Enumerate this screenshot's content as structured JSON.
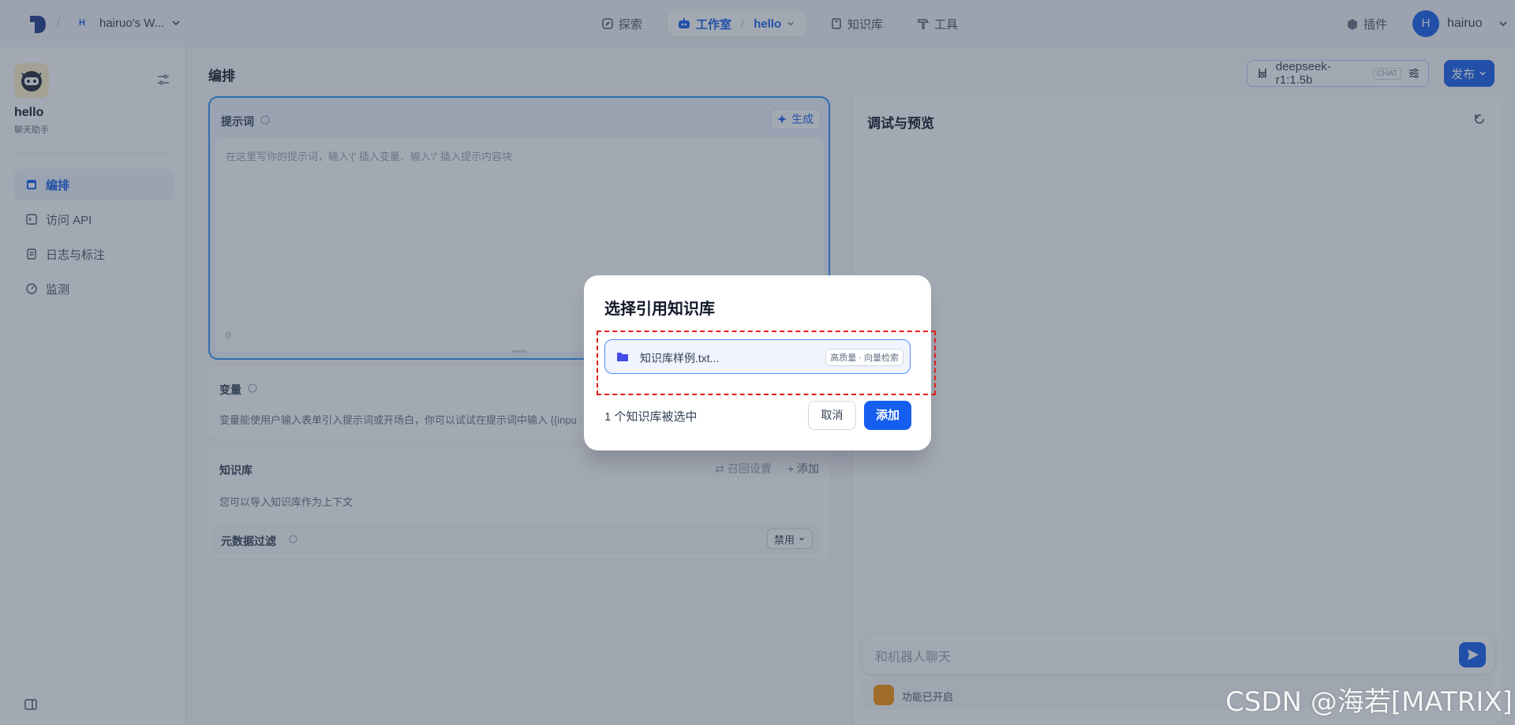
{
  "header": {
    "workspace_initial": "H",
    "workspace_name": "hairuo's W...",
    "nav": {
      "explore": "探索",
      "studio": "工作室",
      "studio_app": "hello",
      "knowledge": "知识库",
      "tools": "工具"
    },
    "plugins": "插件",
    "user_initial": "H",
    "user_name": "hairuo"
  },
  "sidebar": {
    "app_name": "hello",
    "app_type": "聊天助手",
    "items": [
      {
        "label": "编排",
        "active": true,
        "icon": "layout-icon"
      },
      {
        "label": "访问 API",
        "active": false,
        "icon": "terminal-icon"
      },
      {
        "label": "日志与标注",
        "active": false,
        "icon": "log-icon"
      },
      {
        "label": "监测",
        "active": false,
        "icon": "monitor-icon"
      }
    ]
  },
  "main": {
    "page_title": "编排",
    "model": {
      "name": "deepseek-r1:1.5b",
      "tag": "CHAT"
    },
    "publish": "发布",
    "prompt": {
      "label": "提示词",
      "generate": "生成",
      "placeholder": "在这里写你的提示词，输入'{' 插入变量、输入'/' 插入提示内容块",
      "count": "0"
    },
    "variables": {
      "title": "变量",
      "desc": "变量能使用户输入表单引入提示词或开场白，你可以试试在提示词中输入 {{inpu"
    },
    "knowledge": {
      "title": "知识库",
      "recall": "召回设置",
      "add": "添加",
      "desc": "您可以导入知识库作为上下文",
      "meta_filter": "元数据过滤",
      "meta_value": "禁用"
    }
  },
  "debug": {
    "title": "调试与预览",
    "chat_placeholder": "和机器人聊天",
    "feature": "功能已开启"
  },
  "modal": {
    "title": "选择引用知识库",
    "item_name": "知识库样例.txt...",
    "item_badge": "高质量 · 向量检索",
    "count": "1 个知识库被选中",
    "cancel": "取消",
    "add": "添加"
  },
  "watermark": "CSDN @海若[MATRIX]",
  "colors": {
    "primary": "#155eef",
    "annotation": "#e01e1e",
    "overlay": "rgba(52,64,84,0.45)"
  }
}
